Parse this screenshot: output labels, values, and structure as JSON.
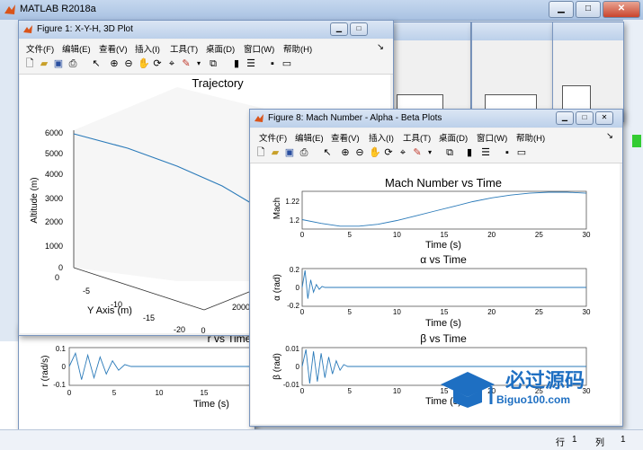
{
  "app": {
    "title": "MATLAB R2018a"
  },
  "status": {
    "row_label": "行",
    "row_value": "1",
    "col_label": "列",
    "col_value": "1"
  },
  "menu": [
    "文件(F)",
    "编辑(E)",
    "查看(V)",
    "插入(I)",
    "工具(T)",
    "桌面(D)",
    "窗口(W)",
    "帮助(H)"
  ],
  "fig1": {
    "title": "Figure 1: X-Y-H, 3D Plot",
    "plot_title": "Trajectory",
    "zlabel": "Altitude (m)",
    "ylabel": "Y Axis (m)",
    "zticks": [
      "6000",
      "5000",
      "4000",
      "3000",
      "2000",
      "1000",
      "0"
    ],
    "yticks": [
      "0",
      "-5",
      "-10",
      "-15",
      "-20"
    ],
    "xticks": [
      "0",
      "2000"
    ],
    "extra_tick": "0"
  },
  "fig8": {
    "title": "Figure 8: Mach Number - Alpha - Beta Plots",
    "mach_title": "Mach Number vs Time",
    "mach_ylabel": "Mach",
    "mach_yticks": [
      "1.22",
      "1.2"
    ],
    "alpha_title": "α vs Time",
    "alpha_ylabel": "α (rad)",
    "alpha_yticks": [
      "0.2",
      "0",
      "-0.2"
    ],
    "beta_title": "β vs Time",
    "beta_ylabel": "β (rad)",
    "beta_yticks": [
      "0.01",
      "0",
      "-0.01"
    ],
    "xlabel": "Time (s)",
    "xticks": [
      "0",
      "5",
      "10",
      "15",
      "20",
      "25",
      "30"
    ]
  },
  "bg": {
    "r_title": "r vs Time",
    "r_ylabel": "r (rad/s)",
    "r_yticks": [
      "0.1",
      "0",
      "-0.1"
    ],
    "xticks": [
      "0",
      "5",
      "10",
      "15"
    ],
    "xlabel": "Time (s)"
  },
  "watermark": {
    "brand": "必过源码",
    "url": "Biguo100.com"
  },
  "chart_data": [
    {
      "type": "line",
      "title": "Mach Number vs Time",
      "xlabel": "Time (s)",
      "ylabel": "Mach",
      "xlim": [
        0,
        30
      ],
      "ylim": [
        1.19,
        1.23
      ],
      "x": [
        0,
        2,
        4,
        6,
        8,
        10,
        12,
        14,
        16,
        18,
        20,
        22,
        24,
        26,
        28,
        30
      ],
      "y": [
        1.2,
        1.196,
        1.193,
        1.193,
        1.195,
        1.199,
        1.204,
        1.209,
        1.214,
        1.219,
        1.223,
        1.226,
        1.228,
        1.229,
        1.229,
        1.228
      ]
    },
    {
      "type": "line",
      "title": "α vs Time",
      "xlabel": "Time (s)",
      "ylabel": "α (rad)",
      "xlim": [
        0,
        30
      ],
      "ylim": [
        -0.2,
        0.2
      ],
      "x": [
        0,
        0.3,
        0.6,
        0.9,
        1.2,
        1.5,
        1.8,
        2.1,
        2.4,
        3,
        30
      ],
      "y": [
        0,
        0.18,
        -0.12,
        0.08,
        -0.05,
        0.03,
        -0.02,
        0.01,
        0,
        0,
        0
      ]
    },
    {
      "type": "line",
      "title": "β vs Time",
      "xlabel": "Time (s)",
      "ylabel": "β (rad)",
      "xlim": [
        0,
        30
      ],
      "ylim": [
        -0.01,
        0.01
      ],
      "x": [
        0,
        0.4,
        0.8,
        1.2,
        1.6,
        2,
        2.4,
        2.8,
        3.2,
        3.6,
        4,
        4.4,
        4.8,
        30
      ],
      "y": [
        0,
        0.009,
        -0.009,
        0.008,
        -0.008,
        0.007,
        -0.006,
        0.005,
        -0.004,
        0.003,
        -0.002,
        0.001,
        0,
        0
      ]
    },
    {
      "type": "line",
      "title": "r vs Time",
      "xlabel": "Time (s)",
      "ylabel": "r (rad/s)",
      "xlim": [
        0,
        15
      ],
      "ylim": [
        -0.1,
        0.1
      ],
      "x": [
        0,
        0.5,
        1,
        1.5,
        2,
        2.5,
        3,
        3.5,
        4,
        4.5,
        5,
        15
      ],
      "y": [
        0,
        0.07,
        -0.07,
        0.06,
        -0.06,
        0.05,
        -0.04,
        0.03,
        -0.02,
        0.01,
        0,
        0
      ]
    },
    {
      "type": "line",
      "title": "Trajectory",
      "zlabel": "Altitude (m)",
      "ylabel": "Y Axis (m)",
      "x": [
        0,
        1000,
        2000
      ],
      "altitude": [
        6000,
        5200,
        3500
      ]
    }
  ]
}
